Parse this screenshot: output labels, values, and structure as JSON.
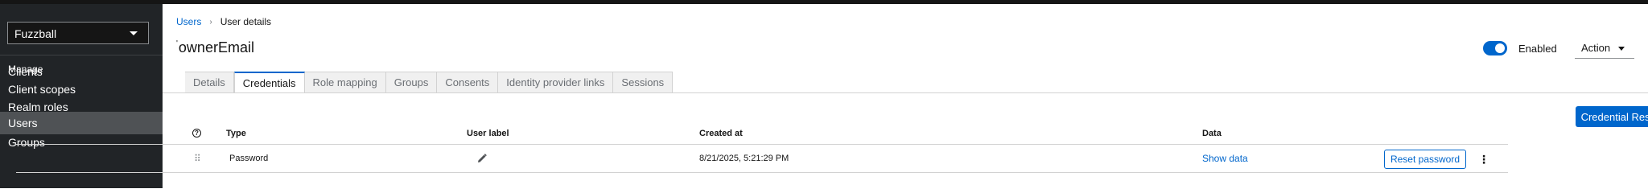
{
  "sidebar": {
    "realm_select": "Fuzzball",
    "group_title": "Manage",
    "items": [
      {
        "label": "Clients"
      },
      {
        "label": "Client scopes"
      },
      {
        "label": "Realm roles"
      },
      {
        "label": "Users",
        "active": true
      },
      {
        "label": "Groups"
      }
    ]
  },
  "breadcrumb": {
    "parent": "Users",
    "current": "User details"
  },
  "page": {
    "title": "ownerEmail",
    "title_prefix": "'"
  },
  "header": {
    "enabled_label": "Enabled",
    "enabled": true,
    "action_label": "Action"
  },
  "tabs": [
    {
      "label": "Details"
    },
    {
      "label": "Credentials",
      "active": true
    },
    {
      "label": "Role mapping"
    },
    {
      "label": "Groups"
    },
    {
      "label": "Consents"
    },
    {
      "label": "Identity provider links"
    },
    {
      "label": "Sessions"
    }
  ],
  "credential_reset_label": "Credential Reset",
  "table": {
    "headers": {
      "type": "Type",
      "user_label": "User label",
      "created_at": "Created at",
      "data": "Data"
    },
    "rows": [
      {
        "type": "Password",
        "user_label": "",
        "created_at": "8/21/2025, 5:21:29 PM",
        "data_link": "Show data",
        "reset_label": "Reset password"
      }
    ]
  },
  "colors": {
    "accent": "#0066cc",
    "sidebar_bg": "#212427",
    "sidebar_active": "#4f5255"
  }
}
